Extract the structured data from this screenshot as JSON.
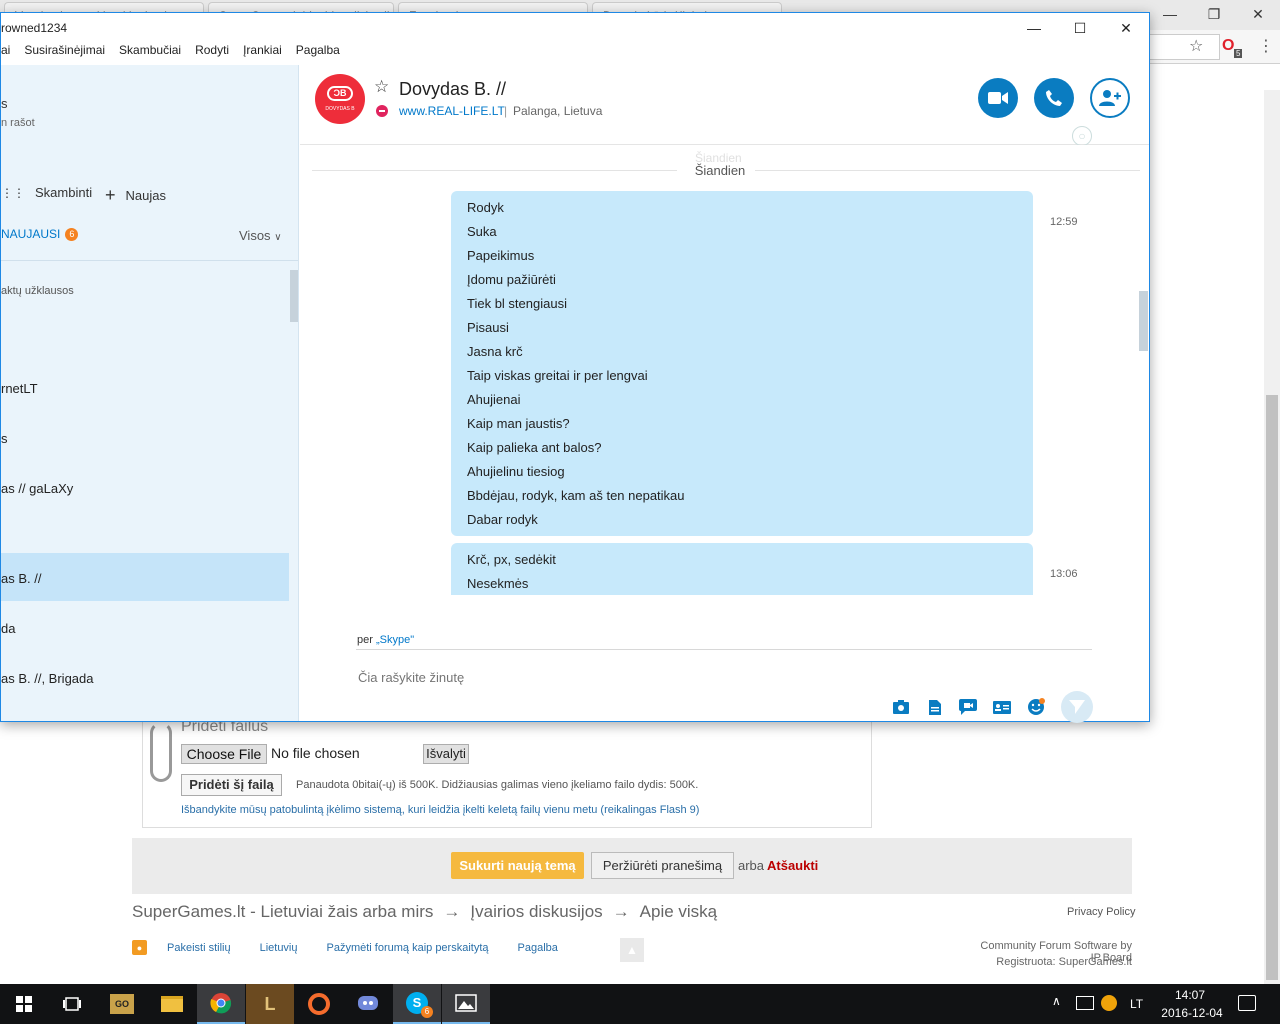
{
  "browser": {
    "tabs": [
      "Vaccination and health checks...",
      "SuperGames.lt | Įvairios diskusijos",
      "Facebook",
      "Dovydo kūrinėliai akyse"
    ],
    "opera_badge": "5"
  },
  "forum": {
    "upload_title": "Pridėti failus",
    "choose_file_label": "Choose File",
    "no_file_text": "No file chosen",
    "clear_label": "Išvalyti",
    "attach_label": "Pridėti šį failą",
    "usage_text": "Panaudota 0bitai(-ų) iš 500K. Didžiausias galimas vieno įkeliamo failo dydis: 500K.",
    "flash_link": "Išbandykite mūsų patobulintą įkėlimo sistemą, kuri leidžia įkelti keletą failų vienu metu (reikalingas Flash 9)",
    "create_topic_label": "Sukurti naują temą",
    "preview_label": "Peržiūrėti pranešimą",
    "or_text": "arba",
    "cancel_label": "Atšaukti",
    "breadcrumb": [
      "SuperGames.lt - Lietuviai žais arba mirs",
      "→",
      "Įvairios diskusijos",
      "→",
      "Apie viską"
    ],
    "privacy_label": "Privacy Policy",
    "footer_links": [
      "Pakeisti stilių",
      "Lietuvių",
      "Pažymėti forumą kaip perskaitytą",
      "Pagalba"
    ],
    "powered_by": "Community Forum Software by IP.Board",
    "registered": "Registruota: SuperGames.lt"
  },
  "skype": {
    "title": "rowned1234",
    "menu": [
      "ai",
      "Susirašinėjimai",
      "Skambučiai",
      "Rodyti",
      "Įrankiai",
      "Pagalba"
    ],
    "sidebar": {
      "profile_line1": "s",
      "profile_line2": "n rašot",
      "call_label": "Skambinti",
      "new_label": "Naujas",
      "recent_label": "NAUJAUSI",
      "recent_count": "6",
      "filter_label": "Visos",
      "requests_label": "aktų užklausos",
      "contacts": [
        "rnetLT",
        "s",
        "as // gaLaXy",
        "as B. //",
        "da",
        "as B. //, Brigada"
      ]
    },
    "header": {
      "contact_name": "Dovydas B. //",
      "avatar_text": "ƆB",
      "avatar_sub": "DOVYDAS B",
      "mood_link": "www.REAL-LIFE.LT",
      "separator": "|",
      "location": "Palanga, Lietuva"
    },
    "chat": {
      "prev_day": "Šiandien",
      "day_label": "Šiandien",
      "messages": [
        {
          "time": "12:59",
          "lines": [
            "Rodyk",
            "Suka",
            "Papeikimus",
            "Įdomu pažiūrėti",
            "Tiek bl stengiausi",
            "Pisausi",
            "Jasna krč",
            "Taip viskas greitai ir  per lengvai",
            "Ahujienai",
            "Kaip man jaustis?",
            "Kaip palieka ant balos?",
            "Ahujielinu tiesiog",
            "Bbdėjau, rodyk, kam aš ten nepatikau",
            "Dabar rodyk"
          ]
        },
        {
          "time": "13:06",
          "lines": [
            "Krč, px, sedėkit",
            "Nesekmės"
          ]
        }
      ],
      "via_prefix": "per",
      "via_service": "„Skype\"",
      "compose_placeholder": "Čia rašykite žinutę"
    }
  },
  "taskbar": {
    "skype_badge": "6",
    "language": "LT",
    "time": "14:07",
    "date": "2016-12-04"
  }
}
